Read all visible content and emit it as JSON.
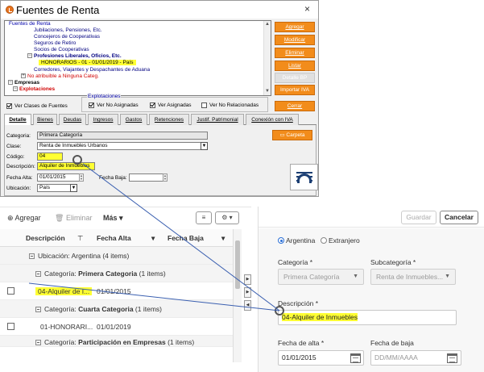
{
  "dialog": {
    "title": "Fuentes de Renta",
    "close_glyph": "×",
    "tree_legend": "Fuentes de Renta",
    "tree_items": [
      "Jubilaciones, Pensiones, Etc.",
      "Concejeros de Cooperativas",
      "Seguros de Retiro",
      "Socios de Cooperativas",
      "Profesiones Liberales, Oficios, Etc.",
      "HONORARIOS - 01 - 01/01/2019 - País",
      "Corredores, Viajantes y Despachantes de Aduana",
      "No atribuible a Ninguna Categ.",
      "Empresas",
      "Explotaciones"
    ],
    "buttons": {
      "agregar": "Agregar",
      "modificar": "Modificar",
      "eliminar": "Eliminar",
      "listar": "Listar",
      "detalle_bp": "Detalle BP",
      "importar_iva": "Importar IVA",
      "cerrar": "Cerrar"
    },
    "ver_clases": "Ver Clases de Fuentes",
    "explotaciones_legend": "Explotaciones",
    "ver_no_asignadas": "Ver No Asignadas",
    "ver_asignadas": "Ver Asignadas",
    "ver_no_relacionadas": "Ver No Relacionadas",
    "tabs": [
      "Detalle",
      "Bienes",
      "Deudas",
      "Ingresos",
      "Gastos",
      "Retenciones",
      "Justif. Patrimonial",
      "Conexión con IVA"
    ],
    "form": {
      "categoria_label": "Categoria:",
      "categoria_value": "Primera Categoría",
      "clase_label": "Clase:",
      "clase_value": "Renta de Inmuebles Urbanos",
      "codigo_label": "Código:",
      "codigo_value": "04",
      "descripcion_label": "Descripción:",
      "descripcion_value": "Alquiler de Inmuebles",
      "fecha_alta_label": "Fecha Alta:",
      "fecha_alta_value": "01/01/2015",
      "fecha_baja_label": "Fecha Baja:",
      "fecha_baja_value": "",
      "ubicacion_label": "Ubicación:",
      "ubicacion_value": "País",
      "carpeta_button": "Carpeta"
    }
  },
  "list": {
    "toolbar": {
      "agregar": "Agregar",
      "eliminar": "Eliminar",
      "mas": "Más ▾"
    },
    "columns": [
      "Descripción",
      "Fecha Alta",
      "Fecha Baja"
    ],
    "rows": [
      {
        "type": "group1",
        "text": "Ubicación: Argentina (4 items)"
      },
      {
        "type": "group2",
        "prefix": "Categoría: ",
        "bold": "Primera Categoria",
        "suffix": " (1 items)"
      },
      {
        "type": "data",
        "desc": "04-Alquiler de I...",
        "alta": "01/01/2015",
        "hl": true
      },
      {
        "type": "group2",
        "prefix": "Categoría: ",
        "bold": "Cuarta Categoria",
        "suffix": " (1 items)"
      },
      {
        "type": "data",
        "desc": "01-HONORARI...",
        "alta": "01/01/2019",
        "hl": false
      },
      {
        "type": "group2",
        "prefix": "Categoría: ",
        "bold": "Participación en Empresas",
        "suffix": " (1 items)"
      }
    ]
  },
  "detail_form": {
    "guardar": "Guardar",
    "cancelar": "Cancelar",
    "radio_argentina": "Argentina",
    "radio_extranjero": "Extranjero",
    "categoria_label": "Categoría *",
    "categoria_value": "Primera Categoría",
    "subcategoria_label": "Subcategoría *",
    "subcategoria_value": "Renta de Inmuebles...",
    "descripcion_label": "Descripción *",
    "descripcion_value": "04-Alquiler de Inmuebles",
    "fecha_alta_label": "Fecha de alta *",
    "fecha_alta_value": "01/01/2015",
    "fecha_baja_label": "Fecha de baja",
    "fecha_baja_placeholder": "DD/MM/AAAA"
  },
  "colors": {
    "orange_button": "#f28c1b",
    "highlight": "#ffff33",
    "tree_link": "#000080",
    "red_text": "#d00000",
    "connector_line": "#3a5fb0"
  }
}
